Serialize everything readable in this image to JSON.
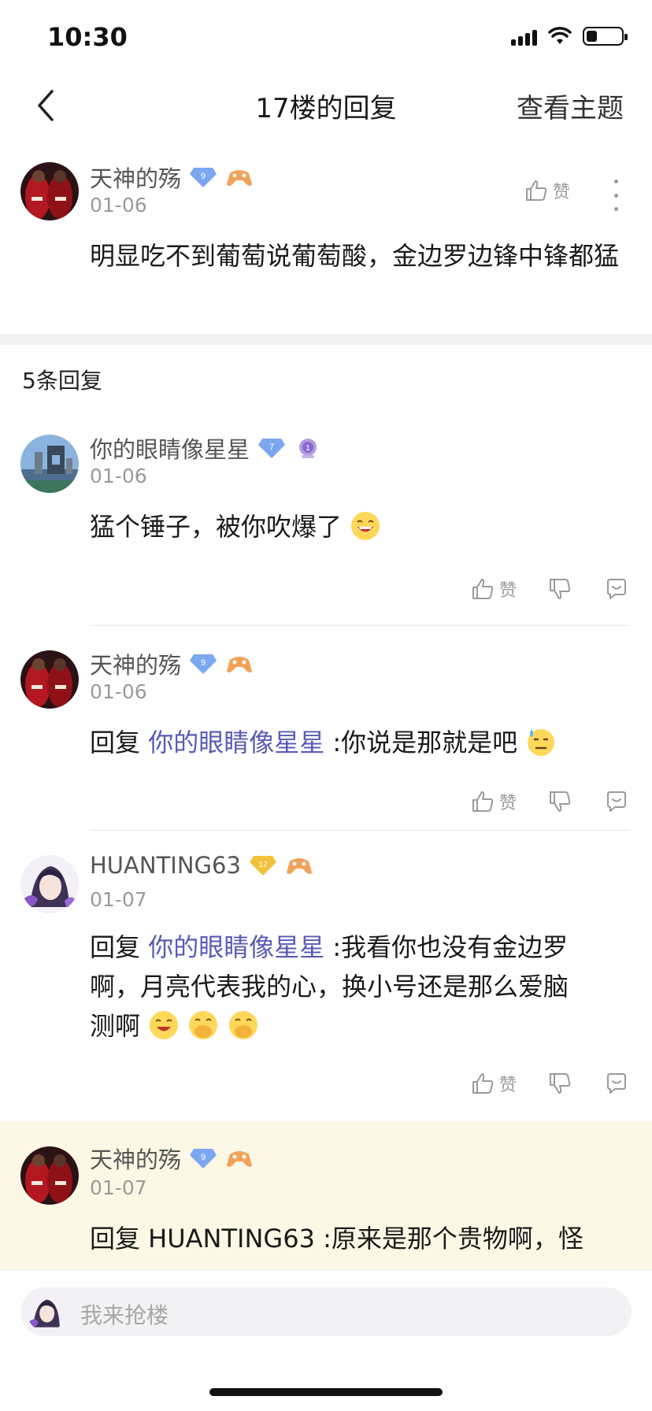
{
  "status_bar": {
    "time": "10:30"
  },
  "header": {
    "title": "17楼的回复",
    "action": "查看主题"
  },
  "main_post": {
    "username": "天神的殇",
    "level": "9",
    "date": "01-06",
    "content": "明显吃不到葡萄说葡萄酸，金边罗边锋中锋都猛",
    "like_label": "赞"
  },
  "reply_count": "5条回复",
  "comments": [
    {
      "username": "你的眼睛像星星",
      "level": "7",
      "date": "01-06",
      "content": "猛个锤子，被你吹爆了",
      "like_label": "赞"
    },
    {
      "username": "天神的殇",
      "level": "9",
      "date": "01-06",
      "reply_prefix": "回复",
      "mention": "你的眼睛像星星",
      "content": ":你说是那就是吧",
      "like_label": "赞"
    },
    {
      "username": "HUANTING63",
      "level": "12",
      "date": "01-07",
      "reply_prefix": "回复",
      "mention": "你的眼睛像星星",
      "content_line1": ":我看你也没有金边罗",
      "content_line2": "啊，月亮代表我的心，换小号还是那么爱脑",
      "content_line3": "测啊",
      "like_label": "赞"
    },
    {
      "username": "天神的殇",
      "level": "9",
      "date": "01-07",
      "content": "回复 HUANTING63 :原来是那个贵物啊，怪"
    }
  ],
  "input": {
    "placeholder": "我来抢楼"
  },
  "colors": {
    "mention": "#5a5ab8",
    "highlight_bg": "#fdf8e6",
    "secondary_text": "#9a9a9a"
  }
}
